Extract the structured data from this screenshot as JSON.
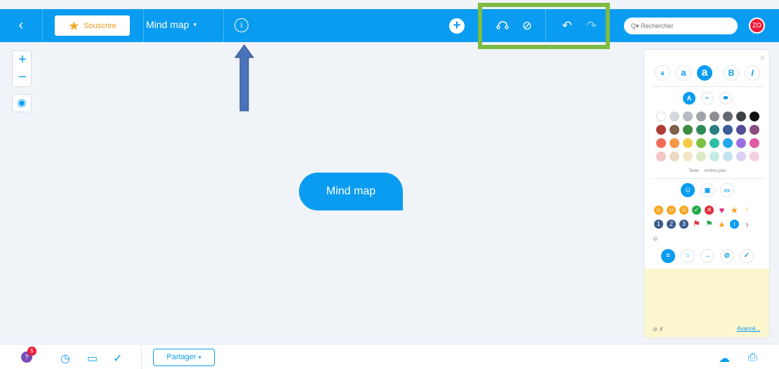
{
  "topbar": {
    "back_icon": "chevron-left-icon",
    "subscribe_label": "Souscrire",
    "map_title": "Mind map",
    "map_title_caret": "▾",
    "info_icon": "info-icon",
    "add_icon": "plus-circle-icon",
    "connect_icon": "connection-icon",
    "clear_icon": "no-style-icon",
    "undo_icon": "undo-icon",
    "redo_icon": "redo-icon",
    "search_placeholder": "Q▾ Rechercher",
    "avatar_initials": "ZO"
  },
  "canvas": {
    "zoom_in": "+",
    "zoom_out": "−",
    "locate_icon": "target-icon",
    "node_label": "Mind map"
  },
  "colors": {
    "brand_blue": "#0a9cf0",
    "highlight_green": "#7dbb43",
    "annotation_arrow": "#4a72b8"
  },
  "panel": {
    "close": "×",
    "text_sizes": [
      "a",
      "a",
      "a"
    ],
    "bold": "B",
    "italic": "I",
    "text_label": "Texte",
    "bg_label": "Arrière-plan",
    "swatches": [
      "#ffffff",
      "#d5d8db",
      "#b8bcc0",
      "#9fa3a7",
      "#8a8e92",
      "#666a6e",
      "#3e4246",
      "#111111",
      "#b23a35",
      "#7d6148",
      "#3d8b3d",
      "#2e8b57",
      "#2a7f86",
      "#3d5a9a",
      "#534c9a",
      "#8a4d80",
      "#f16b5a",
      "#f39a4a",
      "#f3cd4a",
      "#7dc245",
      "#2dc0a5",
      "#23a7e8",
      "#9a6ee0",
      "#e05aa5",
      "#f2c8c4",
      "#ecd8c2",
      "#f1e7c6",
      "#d9ecc8",
      "#c6ebe4",
      "#c6e3f4",
      "#dcd1f1",
      "#f3cfe2"
    ],
    "emoji_row1": [
      "smile",
      "smile",
      "smile",
      "check",
      "cross",
      "heart",
      "star",
      "bulb"
    ],
    "emoji_row2": [
      "1",
      "2",
      "3",
      "flag-red",
      "flag-green",
      "warning",
      "info"
    ],
    "more": "›",
    "none_icon": "⊘",
    "note_footer_icons": "⊘  ✗",
    "advanced_link": "Avancé..."
  },
  "bottombar": {
    "badge_count": "5",
    "history_icon": "history-icon",
    "present_icon": "presentation-icon",
    "check_icon": "check-icon",
    "share_label": "Partager",
    "share_caret": "▾",
    "download_icon": "cloud-download-icon",
    "print_icon": "printer-icon"
  }
}
